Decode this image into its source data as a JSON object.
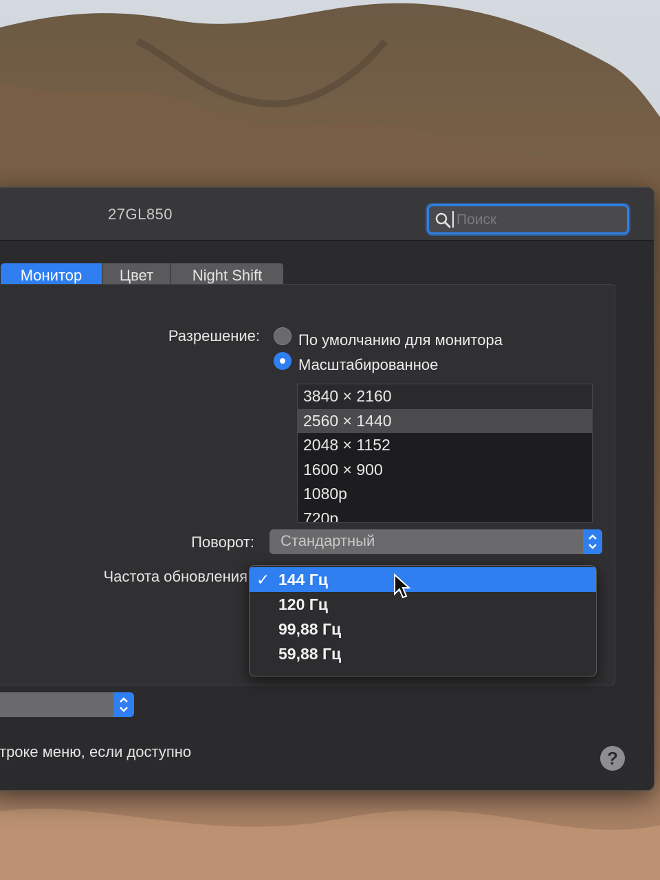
{
  "window": {
    "title": "27GL850",
    "search_placeholder": "Поиск"
  },
  "tabs": [
    {
      "label": "Монитор",
      "active": true
    },
    {
      "label": "Цвет",
      "active": false
    },
    {
      "label": "Night Shift",
      "active": false
    }
  ],
  "resolution": {
    "label": "Разрешение:",
    "options": [
      {
        "label": "По умолчанию для монитора",
        "selected": false
      },
      {
        "label": "Масштабированное",
        "selected": true
      }
    ],
    "list": [
      "3840 × 2160",
      "2560 × 1440",
      "2048 × 1152",
      "1600 × 900",
      "1080p",
      "720p"
    ],
    "selected_item": "2560 × 1440"
  },
  "rotation": {
    "label": "Поворот:",
    "value": "Стандартный"
  },
  "refresh_rate": {
    "label": "Частота обновления",
    "options": [
      "144 Гц",
      "120 Гц",
      "99,88 Гц",
      "59,88 Гц"
    ],
    "selected": "144 Гц",
    "check_glyph": "✓"
  },
  "menubar_option_text": "троке меню, если доступно",
  "help_label": "?",
  "colors": {
    "accent": "#2f7ff0",
    "window_bg": "#2b2b2d"
  }
}
